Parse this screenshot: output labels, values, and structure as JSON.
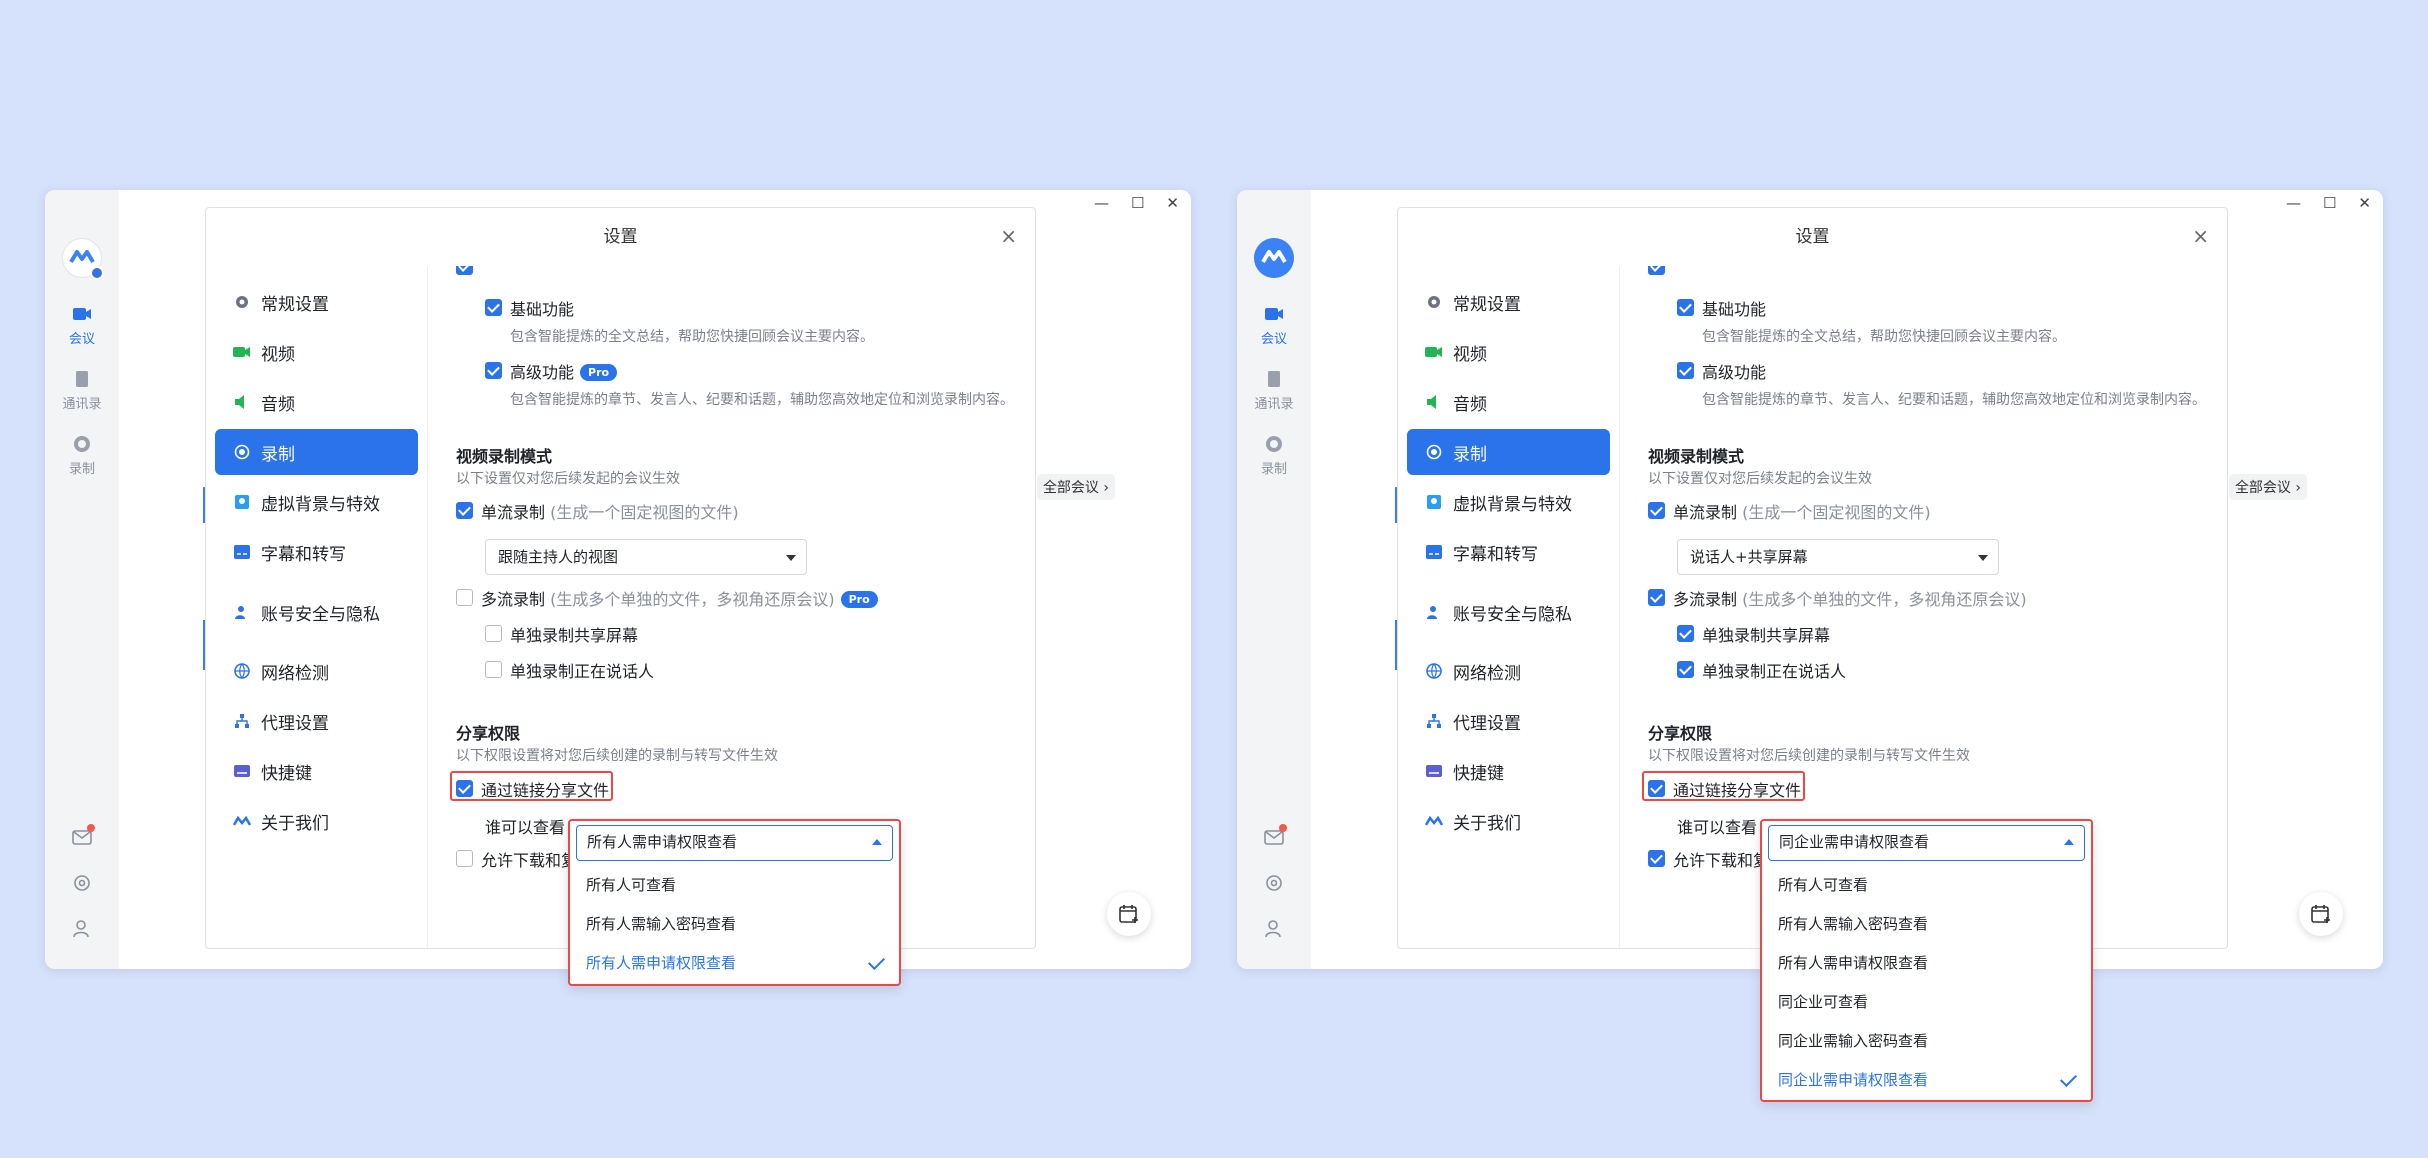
{
  "panels": [
    {
      "window_controls": [
        "—",
        "☐",
        "✕"
      ],
      "rail": {
        "items": [
          {
            "label": "会议",
            "icon": "video-icon",
            "active": true
          },
          {
            "label": "通讯录",
            "icon": "contacts-icon",
            "active": false
          },
          {
            "label": "录制",
            "icon": "record-icon",
            "active": false
          }
        ]
      },
      "all_meetings_label": "全部会议 ›",
      "dialog": {
        "title": "设置",
        "close": "×",
        "sidebar": [
          {
            "label": "常规设置",
            "icon": "gear-icon"
          },
          {
            "label": "视频",
            "icon": "camera-icon"
          },
          {
            "label": "音频",
            "icon": "speaker-icon"
          },
          {
            "label": "录制",
            "icon": "record-icon",
            "active": true
          },
          {
            "label": "虚拟背景与特效",
            "icon": "portrait-icon"
          },
          {
            "label": "字幕和转写",
            "icon": "subtitle-icon"
          },
          {
            "label": "账号安全与隐私",
            "icon": "account-lock-icon"
          },
          {
            "label": "网络检测",
            "icon": "globe-icon"
          },
          {
            "label": "代理设置",
            "icon": "network-tree-icon"
          },
          {
            "label": "快捷键",
            "icon": "keyboard-icon"
          },
          {
            "label": "关于我们",
            "icon": "logo-icon"
          }
        ],
        "basic": {
          "label": "基础功能",
          "desc": "包含智能提炼的全文总结，帮助您快捷回顾会议主要内容。",
          "checked": true
        },
        "advanced": {
          "label": "高级功能",
          "desc": "包含智能提炼的章节、发言人、纪要和话题，辅助您高效地定位和浏览录制内容。",
          "checked": true,
          "pro": "Pro"
        },
        "video_mode": {
          "title": "视频录制模式",
          "desc": "以下设置仅对您后续发起的会议生效",
          "single": {
            "label": "单流录制",
            "hint": "(生成一个固定视图的文件)",
            "checked": true,
            "select": "跟随主持人的视图"
          },
          "multi": {
            "label": "多流录制",
            "hint": "(生成多个单独的文件，多视角还原会议)",
            "checked": false,
            "pro": "Pro"
          },
          "share_screen": {
            "label": "单独录制共享屏幕",
            "checked": false
          },
          "speaker": {
            "label": "单独录制正在说话人",
            "checked": false
          }
        },
        "share": {
          "title": "分享权限",
          "desc": "以下权限设置将对您后续创建的录制与转写文件生效",
          "link": {
            "label": "通过链接分享文件",
            "checked": true
          },
          "who_label": "谁可以查看",
          "allow": {
            "label": "允许下载和复",
            "checked": false
          }
        }
      },
      "dropdown": {
        "selected": "所有人需申请权限查看",
        "options": [
          "所有人可查看",
          "所有人需输入密码查看",
          "所有人需申请权限查看"
        ],
        "selected_index": 2
      }
    },
    {
      "window_controls": [
        "—",
        "☐",
        "✕"
      ],
      "rail": {
        "items": [
          {
            "label": "会议",
            "icon": "video-icon",
            "active": true
          },
          {
            "label": "通讯录",
            "icon": "contacts-icon",
            "active": false
          },
          {
            "label": "录制",
            "icon": "record-icon",
            "active": false
          }
        ]
      },
      "all_meetings_label": "全部会议 ›",
      "dialog": {
        "title": "设置",
        "close": "×",
        "sidebar": [
          {
            "label": "常规设置",
            "icon": "gear-icon"
          },
          {
            "label": "视频",
            "icon": "camera-icon"
          },
          {
            "label": "音频",
            "icon": "speaker-icon"
          },
          {
            "label": "录制",
            "icon": "record-icon",
            "active": true
          },
          {
            "label": "虚拟背景与特效",
            "icon": "portrait-icon"
          },
          {
            "label": "字幕和转写",
            "icon": "subtitle-icon"
          },
          {
            "label": "账号安全与隐私",
            "icon": "account-lock-icon"
          },
          {
            "label": "网络检测",
            "icon": "globe-icon"
          },
          {
            "label": "代理设置",
            "icon": "network-tree-icon"
          },
          {
            "label": "快捷键",
            "icon": "keyboard-icon"
          },
          {
            "label": "关于我们",
            "icon": "logo-icon"
          }
        ],
        "basic": {
          "label": "基础功能",
          "desc": "包含智能提炼的全文总结，帮助您快捷回顾会议主要内容。",
          "checked": true
        },
        "advanced": {
          "label": "高级功能",
          "desc": "包含智能提炼的章节、发言人、纪要和话题，辅助您高效地定位和浏览录制内容。",
          "checked": true,
          "pro": ""
        },
        "video_mode": {
          "title": "视频录制模式",
          "desc": "以下设置仅对您后续发起的会议生效",
          "single": {
            "label": "单流录制",
            "hint": "(生成一个固定视图的文件)",
            "checked": true,
            "select": "说话人+共享屏幕"
          },
          "multi": {
            "label": "多流录制",
            "hint": "(生成多个单独的文件，多视角还原会议)",
            "checked": true,
            "pro": ""
          },
          "share_screen": {
            "label": "单独录制共享屏幕",
            "checked": true
          },
          "speaker": {
            "label": "单独录制正在说话人",
            "checked": true
          }
        },
        "share": {
          "title": "分享权限",
          "desc": "以下权限设置将对您后续创建的录制与转写文件生效",
          "link": {
            "label": "通过链接分享文件",
            "checked": true
          },
          "who_label": "谁可以查看",
          "allow": {
            "label": "允许下载和复",
            "checked": true
          }
        }
      },
      "dropdown": {
        "selected": "同企业需申请权限查看",
        "options": [
          "所有人可查看",
          "所有人需输入密码查看",
          "所有人需申请权限查看",
          "同企业可查看",
          "同企业需输入密码查看",
          "同企业需申请权限查看"
        ],
        "selected_index": 5
      }
    }
  ],
  "colors": {
    "accent": "#2a73ea",
    "highlight": "#e84a4a",
    "background": "#d6e2fb"
  }
}
